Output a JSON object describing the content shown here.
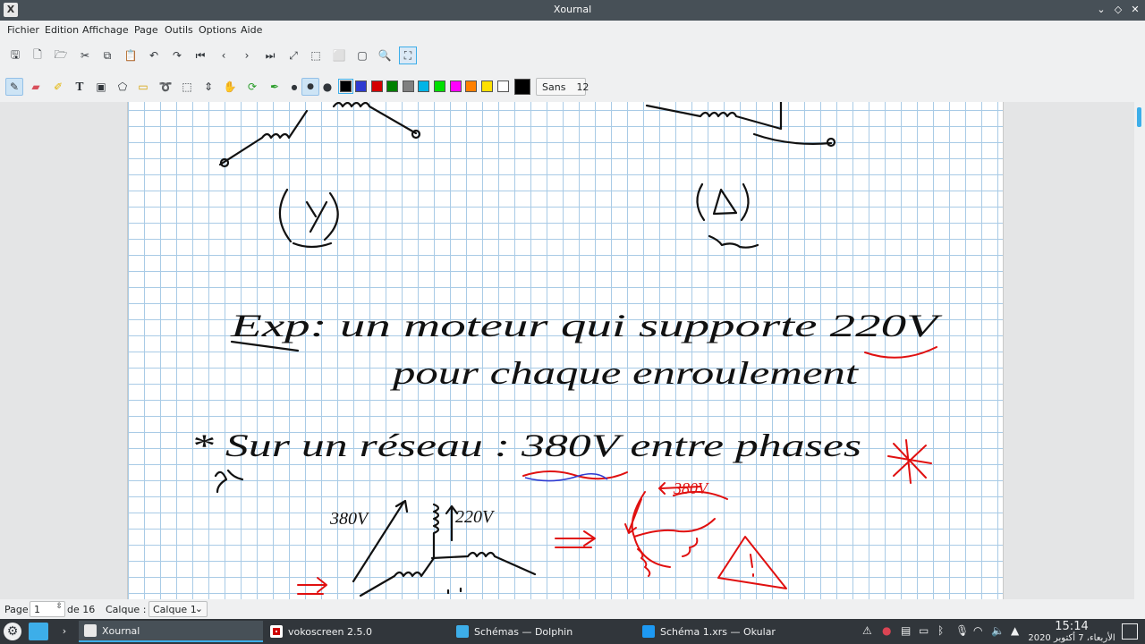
{
  "window": {
    "title": "Xournal",
    "app_icon": "xournal-icon"
  },
  "menu": [
    "Fichier",
    "Edition",
    "Affichage",
    "Page",
    "Outils",
    "Options",
    "Aide"
  ],
  "toolbar": {
    "font_name": "Sans",
    "font_size": "12",
    "colors": [
      "#000000",
      "#2e3bd1",
      "#d40000",
      "#008000",
      "#808080",
      "#00b4e6",
      "#00e000",
      "#ff00ff",
      "#ff8000",
      "#ffe000",
      "#ffffff",
      "#000000"
    ]
  },
  "status": {
    "page_label": "Page",
    "page_value": "1",
    "page_total": "de 16",
    "layer_label": "Calque :",
    "layer_value": "Calque 1"
  },
  "notes": {
    "y_label": "Y",
    "delta_label": "Δ",
    "line1": "Exp: un moteur qui supporte 220V",
    "line2": "pour chaque enroulement",
    "line3": "* Sur un réseau : 380V entre phases",
    "v380_left": "380V",
    "v220": "220V",
    "v380_right": "380V"
  },
  "taskbar": {
    "tasks": [
      "Xournal",
      "vokoscreen 2.5.0",
      "Schémas — Dolphin",
      "Schéma 1.xrs — Okular"
    ],
    "time": "15:14",
    "date": "الأربعاء، 7 أكتوبر 2020"
  }
}
